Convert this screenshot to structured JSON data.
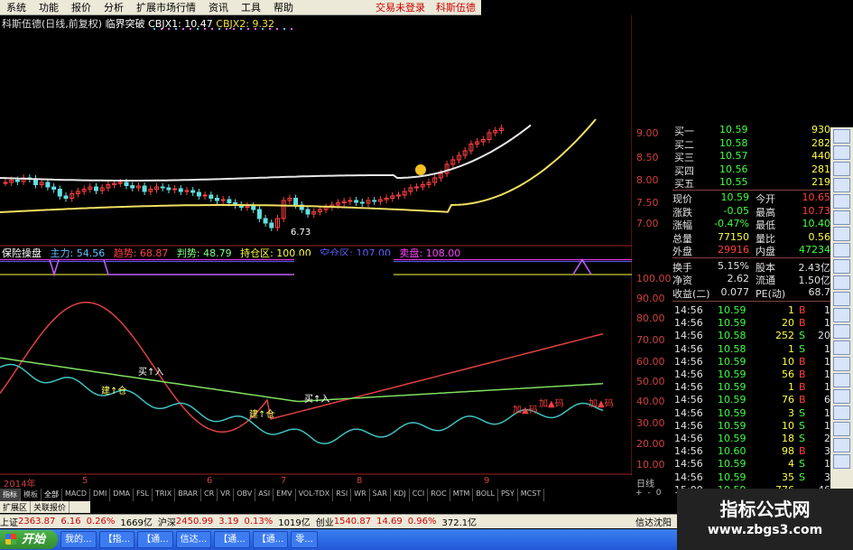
{
  "menu": [
    "系统",
    "功能",
    "报价",
    "分析",
    "扩展市场行情",
    "资讯",
    "工具",
    "帮助"
  ],
  "menu_right": [
    "交易未登录",
    "科斯伍德"
  ],
  "chart_title": {
    "name": "科斯伍德(日线,前复权)",
    "indicator": "临界突破",
    "cbjx1": "CBJX1: 10.47",
    "cbjx2": "CBJX2: 9.32"
  },
  "price_axis": [
    "9.00",
    "8.50",
    "8.00",
    "7.50",
    "7.00"
  ],
  "low_annotation": "6.73",
  "indicator_panel": {
    "name": "保险操盘",
    "items": [
      {
        "label": "主力: 54.56",
        "color": "#60c0ff"
      },
      {
        "label": "趋势: 68.87",
        "color": "#ff4040"
      },
      {
        "label": "判势: 48.79",
        "color": "#80ff80"
      },
      {
        "label": "持仓区: 100.00",
        "color": "#ffff40"
      },
      {
        "label": "空仓区: 107.00",
        "color": "#6060ff"
      },
      {
        "label": "卖盘: 108.00",
        "color": "#ff40ff"
      }
    ],
    "axis": [
      "100.00",
      "90.00",
      "80.00",
      "70.00",
      "60.00",
      "50.00",
      "40.00",
      "30.00",
      "20.00",
      "10.00"
    ],
    "signals": [
      "买↑入",
      "建↑仓",
      "建↑仓",
      "买↑入",
      "加▲码",
      "加▲码",
      "加▲码"
    ]
  },
  "x_axis": {
    "year": "2014年",
    "months": [
      "5",
      "6",
      "7",
      "8",
      "9"
    ],
    "period": "日线"
  },
  "quote": {
    "bids": [
      {
        "label": "买一",
        "price": "10.59",
        "vol": "930"
      },
      {
        "label": "买二",
        "price": "10.58",
        "vol": "282"
      },
      {
        "label": "买三",
        "price": "10.57",
        "vol": "440"
      },
      {
        "label": "买四",
        "price": "10.56",
        "vol": "281"
      },
      {
        "label": "买五",
        "price": "10.55",
        "vol": "219"
      }
    ],
    "stats": [
      {
        "l1": "现价",
        "v1": "10.59",
        "l2": "今开",
        "v2": "10.65"
      },
      {
        "l1": "涨跌",
        "v1": "-0.05",
        "l2": "最高",
        "v2": "10.73"
      },
      {
        "l1": "涨幅",
        "v1": "-0.47%",
        "l2": "最低",
        "v2": "10.40"
      },
      {
        "l1": "总量",
        "v1": "77150",
        "l2": "量比",
        "v2": "0.56"
      },
      {
        "l1": "外盘",
        "v1": "29916",
        "l2": "内盘",
        "v2": "47234"
      },
      {
        "l1": "换手",
        "v1": "5.15%",
        "l2": "股本",
        "v2": "2.43亿"
      },
      {
        "l1": "净资",
        "v1": "2.62",
        "l2": "流通",
        "v2": "1.50亿"
      },
      {
        "l1": "收益(二)",
        "v1": "0.077",
        "l2": "PE(动)",
        "v2": "68.7"
      }
    ],
    "ticks": [
      {
        "t": "14:56",
        "p": "10.59",
        "v": "1",
        "s": "B",
        "n": "1"
      },
      {
        "t": "14:56",
        "p": "10.59",
        "v": "20",
        "s": "B",
        "n": "1"
      },
      {
        "t": "14:56",
        "p": "10.58",
        "v": "252",
        "s": "S",
        "n": "20"
      },
      {
        "t": "14:56",
        "p": "10.58",
        "v": "1",
        "s": "S",
        "n": "1"
      },
      {
        "t": "14:56",
        "p": "10.59",
        "v": "10",
        "s": "B",
        "n": "1"
      },
      {
        "t": "14:56",
        "p": "10.59",
        "v": "56",
        "s": "B",
        "n": "1"
      },
      {
        "t": "14:56",
        "p": "10.59",
        "v": "1",
        "s": "B",
        "n": "1"
      },
      {
        "t": "14:56",
        "p": "10.59",
        "v": "76",
        "s": "B",
        "n": "6"
      },
      {
        "t": "14:56",
        "p": "10.59",
        "v": "3",
        "s": "S",
        "n": "1"
      },
      {
        "t": "14:56",
        "p": "10.59",
        "v": "10",
        "s": "S",
        "n": "1"
      },
      {
        "t": "14:56",
        "p": "10.59",
        "v": "18",
        "s": "S",
        "n": "2"
      },
      {
        "t": "14:56",
        "p": "10.60",
        "v": "98",
        "s": "B",
        "n": "3"
      },
      {
        "t": "14:56",
        "p": "10.59",
        "v": "4",
        "s": "S",
        "n": "1"
      },
      {
        "t": "14:56",
        "p": "10.59",
        "v": "35",
        "s": "S",
        "n": "3"
      },
      {
        "t": "15:00",
        "p": "10.59",
        "v": "776",
        "s": "",
        "n": "46"
      }
    ]
  },
  "indicator_tabs": [
    "指标",
    "模板",
    "全部",
    "MACD",
    "DMI",
    "DMA",
    "FSL",
    "TRIX",
    "BRAR",
    "CR",
    "VR",
    "OBV",
    "ASI",
    "EMV",
    "VOL-TDX",
    "RSI",
    "WR",
    "SAR",
    "KDJ",
    "CCI",
    "ROC",
    "MTM",
    "BOLL",
    "PSY",
    "MCST"
  ],
  "sub_tabs": [
    "扩展区",
    "关联报价"
  ],
  "nav_buttons": [
    "+",
    "-",
    "0"
  ],
  "ticker": [
    {
      "label": "上证",
      "val": "2363.87",
      "chg": "6.16",
      "pct": "0.26%",
      "amt": "1669亿"
    },
    {
      "label": "沪深",
      "val": "2450.99",
      "chg": "3.19",
      "pct": "0.13%",
      "amt": "1019亿"
    },
    {
      "label": "创业",
      "val": "1540.87",
      "chg": "14.69",
      "pct": "0.96%",
      "amt": "372.1亿"
    }
  ],
  "ticker_right": "信达沈阳",
  "taskbar": {
    "start": "开始",
    "tasks": [
      "我的...",
      "【指...",
      "【通...",
      "信达...",
      "【通...",
      "【通...",
      "零..."
    ]
  },
  "watermark": {
    "title": "指标公式网",
    "url": "www.zbgs3.com"
  }
}
